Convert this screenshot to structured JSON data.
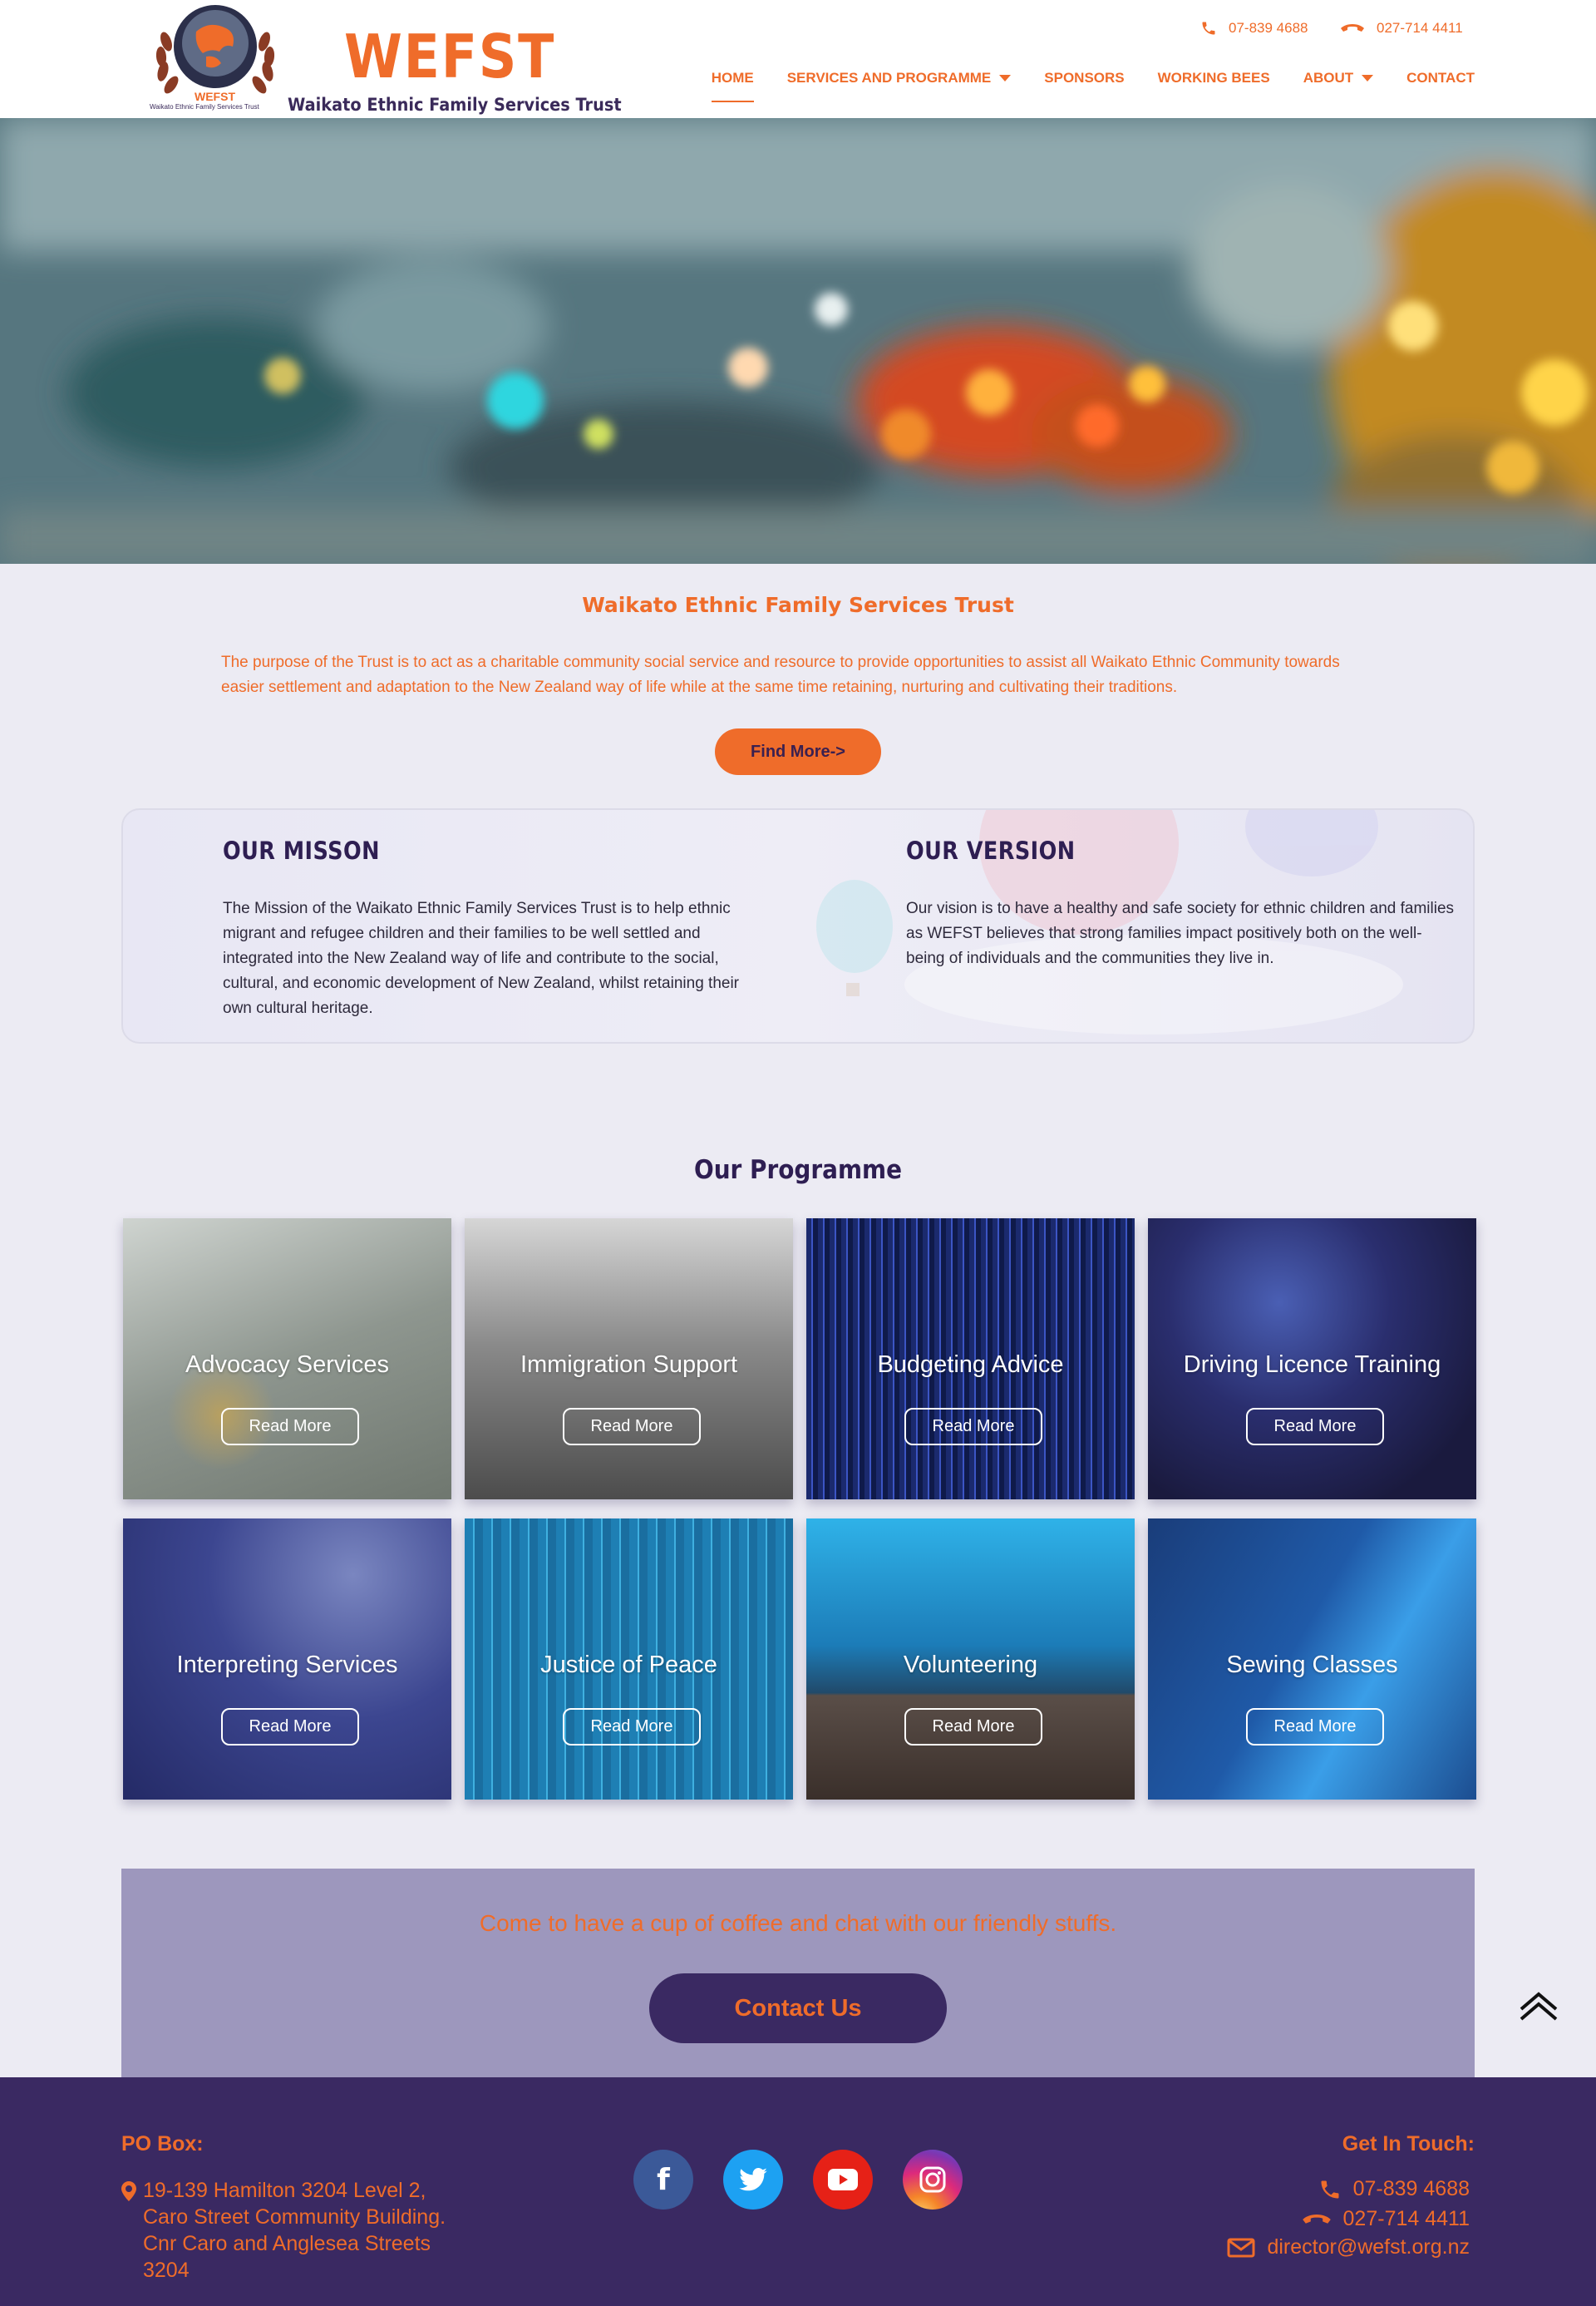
{
  "header": {
    "logo_circle_text": "WEFST",
    "logo_ring_text": "Waikato Ethnic Family Services Trust",
    "brand": "WEFST",
    "brand_tagline": "Waikato Ethnic Family Services Trust",
    "phone1": "07-839 4688",
    "phone2": "027-714 4411",
    "nav": [
      {
        "label": "HOME",
        "active": true,
        "dropdown": false
      },
      {
        "label": "SERVICES AND PROGRAMME",
        "active": false,
        "dropdown": true
      },
      {
        "label": "SPONSORS",
        "active": false,
        "dropdown": false
      },
      {
        "label": "WORKING BEES",
        "active": false,
        "dropdown": false
      },
      {
        "label": "ABOUT",
        "active": false,
        "dropdown": true
      },
      {
        "label": "CONTACT",
        "active": false,
        "dropdown": false
      }
    ]
  },
  "intro": {
    "title": "Waikato Ethnic Family Services Trust",
    "text": "The purpose of the Trust is to act as a charitable community social service and resource to provide opportunities to assist all Waikato Ethnic Community towards easier settlement and adaptation to the New Zealand way of life while at the same time retaining, nurturing and cultivating their traditions.",
    "button": "Find More->"
  },
  "mission": {
    "title": "OUR MISSON",
    "text": "The Mission of the Waikato Ethnic Family Services Trust is to help ethnic migrant and refugee children and their families to be well settled and integrated into the New Zealand way of life and contribute to the social, cultural, and economic development of New Zealand, whilst retaining their own cultural heritage."
  },
  "vision": {
    "title": "OUR VERSION",
    "text": "Our vision is to have a healthy and safe society for ethnic children and families as WEFST believes that strong families impact positively both on the well-being of individuals and the communities they live in."
  },
  "programme": {
    "title": "Our Programme",
    "button_label": "Read More",
    "items": [
      {
        "title": "Advocacy Services"
      },
      {
        "title": "Immigration Support"
      },
      {
        "title": "Budgeting Advice"
      },
      {
        "title": "Driving Licence Training"
      },
      {
        "title": "Interpreting Services"
      },
      {
        "title": "Justice of Peace"
      },
      {
        "title": "Volunteering"
      },
      {
        "title": "Sewing Classes"
      }
    ]
  },
  "cta": {
    "text": "Come to have a cup of coffee and chat with our friendly stuffs.",
    "button": "Contact Us"
  },
  "footer": {
    "po_heading": "PO Box:",
    "address": "19-139 Hamilton 3204 Level 2, Caro Street Community Building. Cnr Caro and Anglesea Streets 3204",
    "social": [
      "facebook-icon",
      "twitter-icon",
      "youtube-icon",
      "instagram-icon"
    ],
    "contact_heading": "Get In Touch:",
    "phone1": "07-839 4688",
    "phone2": "027-714 4411",
    "email": "director@wefst.org.nz"
  },
  "colors": {
    "accent": "#ef6c2a",
    "purple_dark": "#3a2962",
    "cta_bg": "#9d97bd",
    "page_bg": "#ecebf3"
  }
}
